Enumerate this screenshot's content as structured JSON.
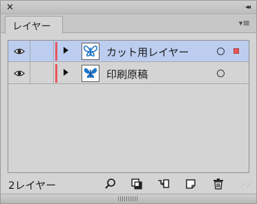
{
  "panel": {
    "close_label": "×",
    "collapse_label": "◂◂",
    "tab_label": "レイヤー",
    "menu_label": "≡"
  },
  "layers": [
    {
      "name": "カット用レイヤー",
      "selected": true,
      "visible": true,
      "color": "#e8555a",
      "thumb_icon": "butterfly-outline",
      "has_selection_indicator": true
    },
    {
      "name": "印刷原稿",
      "selected": false,
      "visible": true,
      "color": "#e8555a",
      "thumb_icon": "butterfly-filled",
      "has_selection_indicator": false
    }
  ],
  "footer": {
    "count_label": "2レイヤー",
    "icons": [
      "locate-object-icon",
      "make-clipping-mask-icon",
      "create-sublayer-icon",
      "create-new-layer-icon",
      "delete-icon"
    ]
  },
  "colors": {
    "selected_row": "#bccdf0",
    "layer_color": "#e8555a",
    "butterfly_blue": "#1e74c8"
  }
}
